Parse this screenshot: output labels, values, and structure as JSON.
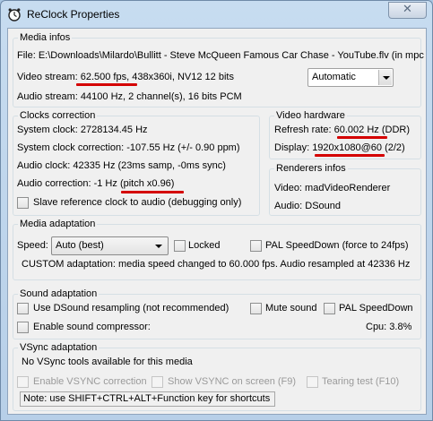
{
  "window": {
    "title": "ReClock Properties",
    "close_glyph": "✕",
    "icon": "clock-icon"
  },
  "media_infos": {
    "legend": "Media infos",
    "file": "File:  E:\\Downloads\\Milardo\\Bullitt - Steve McQueen Famous Car Chase - YouTube.flv (in mpc",
    "video_stream_label": "Video stream: ",
    "video_stream_fps": "62.500 fps",
    "video_stream_rest": ", 438x360i, NV12 12 bits",
    "audio_stream": "Audio stream:  44100 Hz, 2 channel(s), 16 bits PCM",
    "mode_select": "Automatic"
  },
  "clocks_correction": {
    "legend": "Clocks correction",
    "system_clock": "System clock:  2728134.45 Hz",
    "system_clock_correction": "System clock correction:  -107.55 Hz (+/- 0.90 ppm)",
    "audio_clock": "Audio clock:  42335 Hz (23ms samp, -0ms sync)",
    "audio_correction_label": "Audio correction:  -1 Hz ",
    "audio_correction_pitch": "(pitch x0.96)",
    "slave_checkbox": "Slave reference clock to audio (debugging only)"
  },
  "video_hardware": {
    "legend": "Video hardware",
    "refresh_label": "Refresh rate:  ",
    "refresh_value": "60.002 Hz",
    "refresh_suffix": " (DDR)",
    "display_label": "Display:  ",
    "display_value": "1920x1080@60",
    "display_suffix": " (2/2)"
  },
  "renderers_infos": {
    "legend": "Renderers infos",
    "video": "Video: madVideoRenderer",
    "audio": "Audio: DSound"
  },
  "media_adaptation": {
    "legend": "Media adaptation",
    "speed_label": "Speed:",
    "speed_value": "Auto (best)",
    "locked": "Locked",
    "pal_speeddown": "PAL SpeedDown (force to 24fps)",
    "custom_text": "CUSTOM adaptation: media speed changed to 60.000 fps. Audio resampled at 42336 Hz"
  },
  "sound_adaptation": {
    "legend": "Sound adaptation",
    "dsound_resampling": "Use DSound resampling (not recommended)",
    "mute_sound": "Mute sound",
    "pal_speeddown": "PAL SpeedDown",
    "sound_compressor": "Enable sound compressor:",
    "cpu": "Cpu:  3.8%"
  },
  "vsync_adaptation": {
    "legend": "VSync adaptation",
    "no_tools": "No VSync tools available for this media",
    "enable_vsync": "Enable VSYNC correction",
    "show_vsync": "Show VSYNC on screen (F9)",
    "tearing_test": "Tearing test (F10)",
    "note": "Note: use SHIFT+CTRL+ALT+Function key for shortcuts"
  },
  "colors": {
    "annotation_underline": "#d40000",
    "title_bar": "#b7cfe8"
  }
}
